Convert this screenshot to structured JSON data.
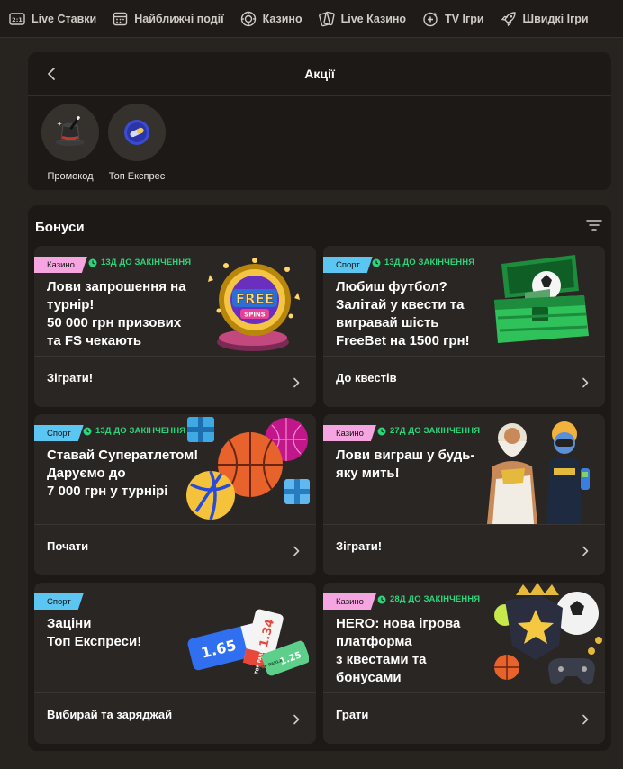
{
  "nav": {
    "items": [
      {
        "label": "Live Ставки",
        "icon": "live-icon"
      },
      {
        "label": "Найближчі події",
        "icon": "calendar-icon"
      },
      {
        "label": "Казино",
        "icon": "casino-chip-icon"
      },
      {
        "label": "Live Казино",
        "icon": "cards-icon"
      },
      {
        "label": "TV Ігри",
        "icon": "tv-games-icon"
      },
      {
        "label": "Швидкі Ігри",
        "icon": "rocket-icon"
      }
    ]
  },
  "promotions": {
    "title": "Акції",
    "items": [
      {
        "label": "Промокод",
        "icon": "magic-hat-icon"
      },
      {
        "label": "Топ Експрес",
        "icon": "express-ticket-icon"
      }
    ]
  },
  "bonuses": {
    "title": "Бонуси",
    "cards": [
      {
        "tag": "Казино",
        "tag_type": "casino",
        "timer": "13Д ДО ЗАКІНЧЕННЯ",
        "title_lines": [
          "Лови запрошення на",
          "турнір!",
          "50 000 грн призових",
          "та FS чекають"
        ],
        "action": "Зіграти!",
        "art_label": "FREE",
        "art_sublabel": "SPINS"
      },
      {
        "tag": "Спорт",
        "tag_type": "sport",
        "timer": "13Д ДО ЗАКІНЧЕННЯ",
        "title_lines": [
          "Любиш футбол?",
          "Залітай у квести та",
          "вигравай шість",
          "FreeBet на 1500 грн!"
        ],
        "action": "До квестів"
      },
      {
        "tag": "Спорт",
        "tag_type": "sport",
        "timer": "13Д ДО ЗАКІНЧЕННЯ",
        "title_lines": [
          "Ставай Суператлетом!",
          "Даруємо до",
          "7 000 грн у турнірі"
        ],
        "action": "Почати"
      },
      {
        "tag": "Казино",
        "tag_type": "casino",
        "timer": "27Д ДО ЗАКІНЧЕННЯ",
        "title_lines": [
          "Лови виграш у будь-",
          "яку мить!"
        ],
        "action": "Зіграти!"
      },
      {
        "tag": "Спорт",
        "tag_type": "sport",
        "timer": "",
        "title_lines": [
          "Заціни",
          "Топ Експреси!"
        ],
        "action": "Вибирай та заряджай",
        "art_odds": [
          "1.65",
          "TOP PARLAY",
          "1.34",
          "TOP PARLAY",
          "1.25"
        ]
      },
      {
        "tag": "Казино",
        "tag_type": "casino",
        "timer": "28Д ДО ЗАКІНЧЕННЯ",
        "title_lines": [
          "HERO: нова ігрова",
          "платформа",
          "з квестами та",
          "бонусами"
        ],
        "action": "Грати"
      }
    ]
  },
  "colors": {
    "page_bg": "#27231f",
    "panel_bg": "#1c1917",
    "card_bg": "#2a2623",
    "timer_green": "#2ed47a",
    "sport_tag": "#5cc6f2",
    "casino_tag": "#f5a6e0"
  }
}
